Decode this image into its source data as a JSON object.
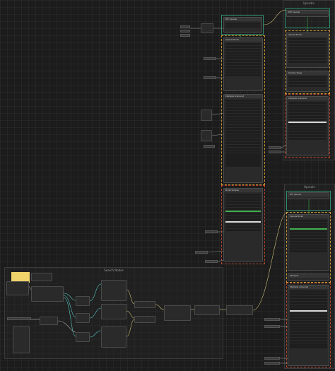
{
  "groups": {
    "upscale_top": "Upscale",
    "upscale_mid": "Upscale",
    "search_nodes": "Search Nodes"
  },
  "nodes": {
    "rtx_upscale": "RTX Upscale",
    "upscale_model": "Upscale Model",
    "ksampler_advanced": "KSampler Advanced",
    "model_sampler": "Model Sampler",
    "sampler_right": "Upscale Model",
    "sampler_stage": "Sampler Stage",
    "sampler_small": "KSampler"
  },
  "colors": {
    "accent_green": "#3fae4a",
    "frame_teal": "#2f8f6f",
    "dash_orange": "#c8962e",
    "dash_red": "#b8452c",
    "note_yellow": "#f0d36a",
    "wire_teal": "#58c7c2",
    "wire_yellow": "#cdbf78"
  }
}
